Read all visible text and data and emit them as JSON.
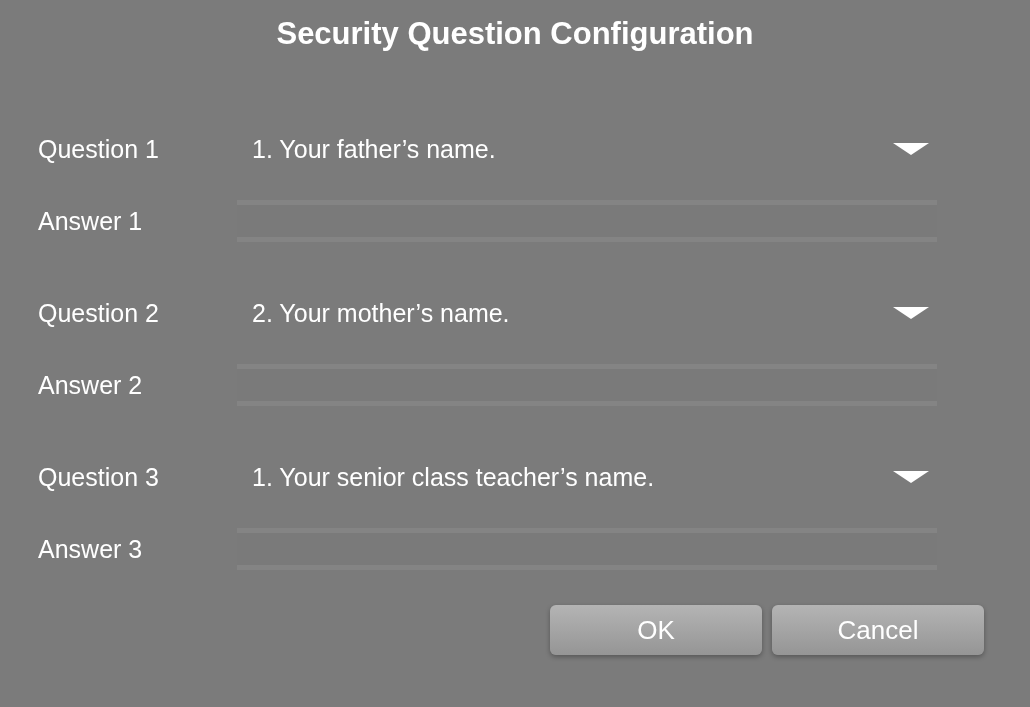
{
  "dialog": {
    "title": "Security Question Configuration"
  },
  "items": [
    {
      "question_label": "Question 1",
      "question": "1. Your father’s name.",
      "answer_label": "Answer 1"
    },
    {
      "question_label": "Question 2",
      "question": "2. Your mother’s name.",
      "answer_label": "Answer 2"
    },
    {
      "question_label": "Question 3",
      "question": "1. Your senior class teacher’s name.",
      "answer_label": "Answer 3"
    }
  ],
  "buttons": [
    "OK",
    "Cancel"
  ]
}
